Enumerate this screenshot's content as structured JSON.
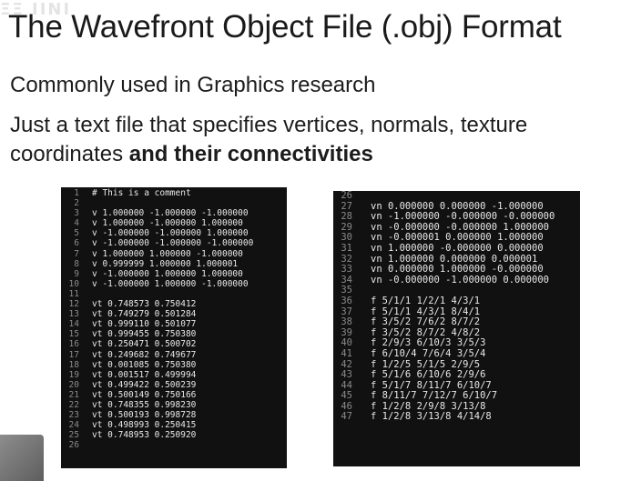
{
  "slide": {
    "title": "The Wavefront Object File (.obj) Format",
    "line1": "Commonly used in Graphics research",
    "line2_a": "Just a text file that specifies vertices, normals, texture",
    "line2_b": "coordinates ",
    "line2_bold": "and their connectivities"
  },
  "code_left": [
    {
      "n": "1",
      "t": "# This is a comment"
    },
    {
      "n": "2",
      "t": ""
    },
    {
      "n": "3",
      "t": "v 1.000000 -1.000000 -1.000000"
    },
    {
      "n": "4",
      "t": "v 1.000000 -1.000000 1.000000"
    },
    {
      "n": "5",
      "t": "v -1.000000 -1.000000 1.000000"
    },
    {
      "n": "6",
      "t": "v -1.000000 -1.000000 -1.000000"
    },
    {
      "n": "7",
      "t": "v 1.000000 1.000000 -1.000000"
    },
    {
      "n": "8",
      "t": "v 0.999999 1.000000 1.000001"
    },
    {
      "n": "9",
      "t": "v -1.000000 1.000000 1.000000"
    },
    {
      "n": "10",
      "t": "v -1.000000 1.000000 -1.000000"
    },
    {
      "n": "11",
      "t": ""
    },
    {
      "n": "12",
      "t": "vt 0.748573 0.750412"
    },
    {
      "n": "13",
      "t": "vt 0.749279 0.501284"
    },
    {
      "n": "14",
      "t": "vt 0.999110 0.501077"
    },
    {
      "n": "15",
      "t": "vt 0.999455 0.750380"
    },
    {
      "n": "16",
      "t": "vt 0.250471 0.500702"
    },
    {
      "n": "17",
      "t": "vt 0.249682 0.749677"
    },
    {
      "n": "18",
      "t": "vt 0.001085 0.750380"
    },
    {
      "n": "19",
      "t": "vt 0.001517 0.499994"
    },
    {
      "n": "20",
      "t": "vt 0.499422 0.500239"
    },
    {
      "n": "21",
      "t": "vt 0.500149 0.750166"
    },
    {
      "n": "22",
      "t": "vt 0.748355 0.998230"
    },
    {
      "n": "23",
      "t": "vt 0.500193 0.998728"
    },
    {
      "n": "24",
      "t": "vt 0.498993 0.250415"
    },
    {
      "n": "25",
      "t": "vt 0.748953 0.250920"
    },
    {
      "n": "26",
      "t": ""
    }
  ],
  "code_right": [
    {
      "n": "26",
      "t": ""
    },
    {
      "n": "27",
      "t": "vn 0.000000 0.000000 -1.000000"
    },
    {
      "n": "28",
      "t": "vn -1.000000 -0.000000 -0.000000"
    },
    {
      "n": "29",
      "t": "vn -0.000000 -0.000000 1.000000"
    },
    {
      "n": "30",
      "t": "vn -0.000001 0.000000 1.000000"
    },
    {
      "n": "31",
      "t": "vn 1.000000 -0.000000 0.000000"
    },
    {
      "n": "32",
      "t": "vn 1.000000 0.000000 0.000001"
    },
    {
      "n": "33",
      "t": "vn 0.000000 1.000000 -0.000000"
    },
    {
      "n": "34",
      "t": "vn -0.000000 -1.000000 0.000000"
    },
    {
      "n": "35",
      "t": ""
    },
    {
      "n": "36",
      "t": "f 5/1/1 1/2/1 4/3/1"
    },
    {
      "n": "37",
      "t": "f 5/1/1 4/3/1 8/4/1"
    },
    {
      "n": "38",
      "t": "f 3/5/2 7/6/2 8/7/2"
    },
    {
      "n": "39",
      "t": "f 3/5/2 8/7/2 4/8/2"
    },
    {
      "n": "40",
      "t": "f 2/9/3 6/10/3 3/5/3"
    },
    {
      "n": "41",
      "t": "f 6/10/4 7/6/4 3/5/4"
    },
    {
      "n": "42",
      "t": "f 1/2/5 5/1/5 2/9/5"
    },
    {
      "n": "43",
      "t": "f 5/1/6 6/10/6 2/9/6"
    },
    {
      "n": "44",
      "t": "f 5/1/7 8/11/7 6/10/7"
    },
    {
      "n": "45",
      "t": "f 8/11/7 7/12/7 6/10/7"
    },
    {
      "n": "46",
      "t": "f 1/2/8 2/9/8 3/13/8"
    },
    {
      "n": "47",
      "t": "f 1/2/8 3/13/8 4/14/8"
    }
  ]
}
